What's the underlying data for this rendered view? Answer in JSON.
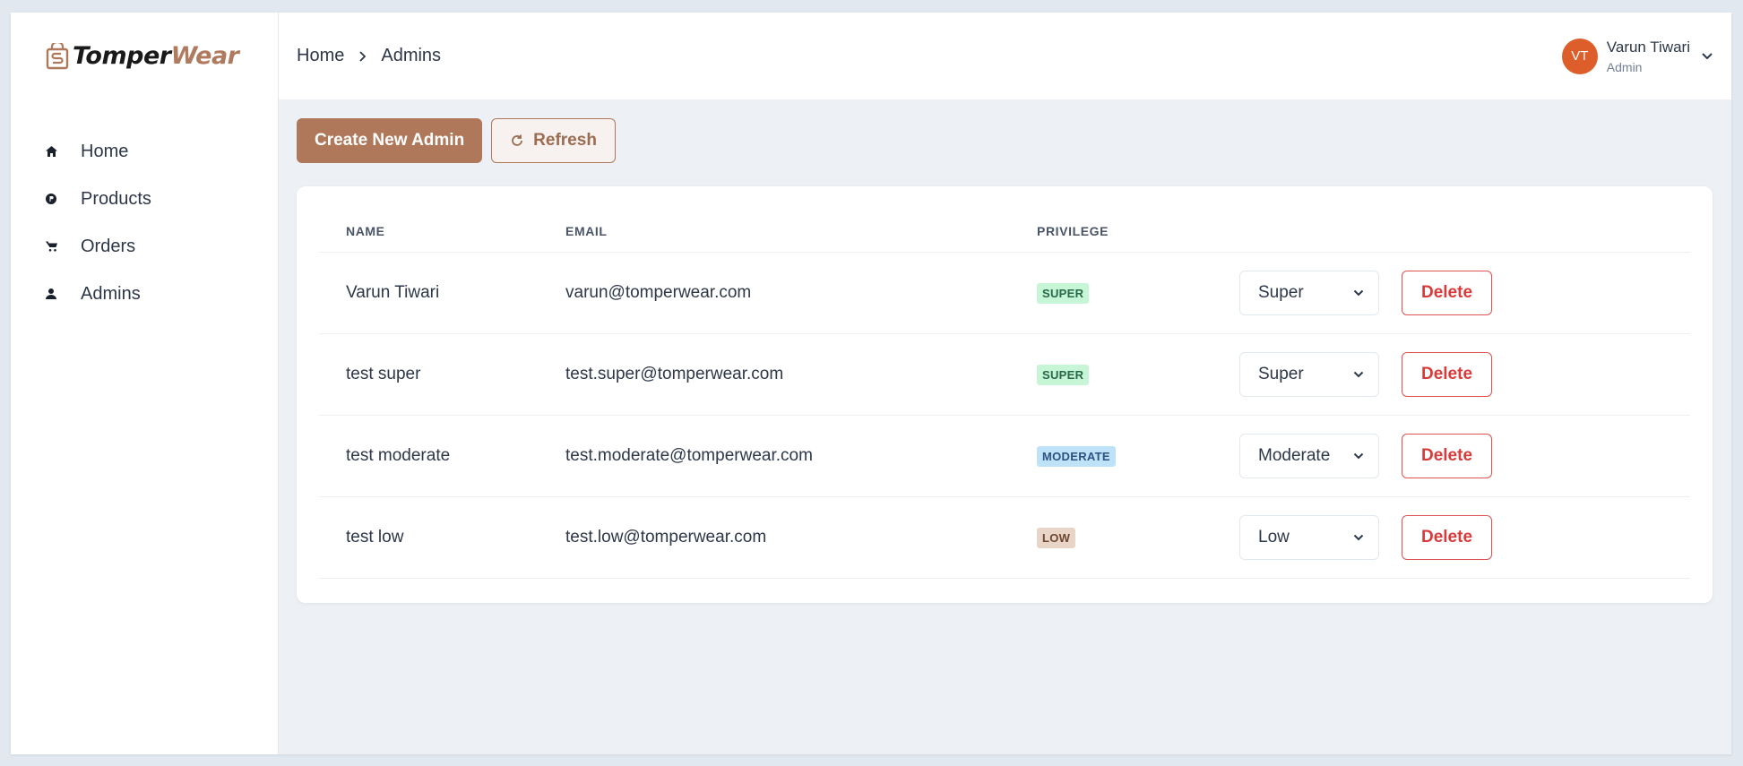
{
  "brand": {
    "part1": "Tomper",
    "part2": "Wear"
  },
  "sidebar": {
    "items": [
      {
        "label": "Home",
        "icon": "home-icon"
      },
      {
        "label": "Products",
        "icon": "products-icon"
      },
      {
        "label": "Orders",
        "icon": "cart-icon"
      },
      {
        "label": "Admins",
        "icon": "user-icon"
      }
    ]
  },
  "header": {
    "breadcrumb": [
      "Home",
      "Admins"
    ],
    "user": {
      "initials": "VT",
      "name": "Varun Tiwari",
      "role": "Admin"
    }
  },
  "actions": {
    "create_label": "Create New Admin",
    "refresh_label": "Refresh"
  },
  "table": {
    "columns": [
      "NAME",
      "EMAIL",
      "PRIVILEGE"
    ],
    "rows": [
      {
        "name": "Varun Tiwari",
        "email": "varun@tomperwear.com",
        "privilege": "SUPER",
        "select": "Super",
        "delete": "Delete"
      },
      {
        "name": "test super",
        "email": "test.super@tomperwear.com",
        "privilege": "SUPER",
        "select": "Super",
        "delete": "Delete"
      },
      {
        "name": "test moderate",
        "email": "test.moderate@tomperwear.com",
        "privilege": "MODERATE",
        "select": "Moderate",
        "delete": "Delete"
      },
      {
        "name": "test low",
        "email": "test.low@tomperwear.com",
        "privilege": "LOW",
        "select": "Low",
        "delete": "Delete"
      }
    ]
  },
  "colors": {
    "accent": "#b0785a",
    "badge_super_bg": "#c6f6d5",
    "badge_super_fg": "#276749",
    "badge_moderate_bg": "#bee3f8",
    "badge_moderate_fg": "#2c5282",
    "badge_low_bg": "#e8d5c8",
    "badge_low_fg": "#6b4530"
  }
}
